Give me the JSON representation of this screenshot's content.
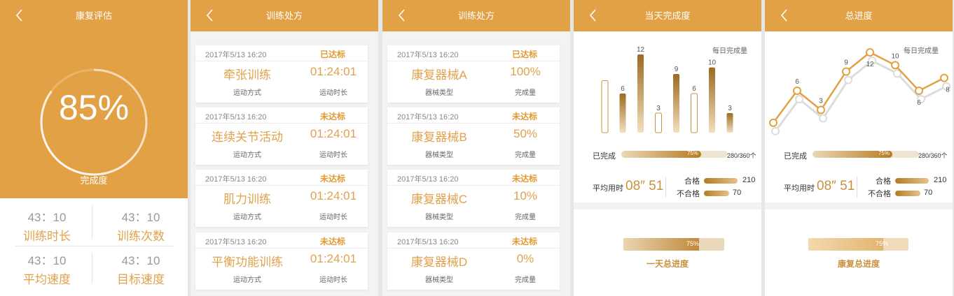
{
  "colors": {
    "accent": "#e3a145",
    "text_accent": "#e0a24c",
    "status": "#e19a33",
    "dark_gold": "#b57c20"
  },
  "screen1": {
    "title": "康复评估",
    "percent": "85%",
    "percent_value": 85,
    "percent_label": "完成度",
    "stats": [
      {
        "value": "43：10",
        "label": "训练时长"
      },
      {
        "value": "43：10",
        "label": "训练次数"
      },
      {
        "value": "43：10",
        "label": "平均速度"
      },
      {
        "value": "43：10",
        "label": "目标速度"
      }
    ]
  },
  "screen2": {
    "title": "训练处方",
    "items": [
      {
        "date": "2017年5/13 16:20",
        "status": "已达标",
        "name": "牵张训练",
        "value": "01:24:01",
        "sub1": "运动方式",
        "sub2": "运动时长"
      },
      {
        "date": "2017年5/13 16:20",
        "status": "未达标",
        "name": "连续关节活动",
        "value": "01:24:01",
        "sub1": "运动方式",
        "sub2": "运动时长"
      },
      {
        "date": "2017年5/13 16:20",
        "status": "未达标",
        "name": "肌力训练",
        "value": "01:24:01",
        "sub1": "运动方式",
        "sub2": "运动时长"
      },
      {
        "date": "2017年5/13 16:20",
        "status": "未达标",
        "name": "平衡功能训练",
        "value": "01:24:01",
        "sub1": "运动方式",
        "sub2": "运动时长"
      }
    ]
  },
  "screen3": {
    "title": "训练处方",
    "items": [
      {
        "date": "2017年5/13 16:20",
        "status": "已达标",
        "name": "康复器械A",
        "value": "100%",
        "sub1": "器械类型",
        "sub2": "完成量"
      },
      {
        "date": "2017年5/13 16:20",
        "status": "未达标",
        "name": "康复器械B",
        "value": "50%",
        "sub1": "器械类型",
        "sub2": "完成量"
      },
      {
        "date": "2017年5/13 16:20",
        "status": "未达标",
        "name": "康复器械C",
        "value": "10%",
        "sub1": "器械类型",
        "sub2": "完成量"
      },
      {
        "date": "2017年5/13 16:20",
        "status": "未达标",
        "name": "康复器械D",
        "value": "0%",
        "sub1": "器械类型",
        "sub2": "完成量"
      }
    ]
  },
  "screen4": {
    "title": "当天完成度",
    "legend": "每日完成量",
    "completed_label": "已完成",
    "completed_percent": "75%",
    "completed_count": "280/360个",
    "completed_fraction": 0.75,
    "avg_label": "平均用时",
    "avg_value": "08″ 51",
    "pass_label": "合格",
    "pass_value": "210",
    "fail_label": "不合格",
    "fail_value": "70",
    "bottom_percent": "75%",
    "bottom_caption": "一天总进度"
  },
  "screen5": {
    "title": "总进度",
    "legend": "每日完成量",
    "completed_label": "已完成",
    "completed_percent": "75%",
    "completed_count": "280/360个",
    "completed_fraction": 0.75,
    "avg_label": "平均用时",
    "avg_value": "08″ 51",
    "pass_label": "合格",
    "pass_value": "210",
    "fail_label": "不合格",
    "fail_value": "70",
    "bottom_percent": "75%",
    "bottom_caption": "康复总进度"
  },
  "chart_data": [
    {
      "type": "bar",
      "title": "每日完成量",
      "series": [
        {
          "values": [
            8,
            6,
            12,
            3,
            9,
            6,
            10,
            3
          ],
          "style": "filled-outline-alternating"
        }
      ]
    },
    {
      "type": "line",
      "title": "每日完成量",
      "series": [
        {
          "values": [
            1,
            6,
            3,
            9,
            12,
            10,
            6,
            8
          ]
        }
      ],
      "labels": [
        "",
        "6",
        "3",
        "9",
        "12",
        "10",
        "6",
        "8"
      ]
    }
  ]
}
